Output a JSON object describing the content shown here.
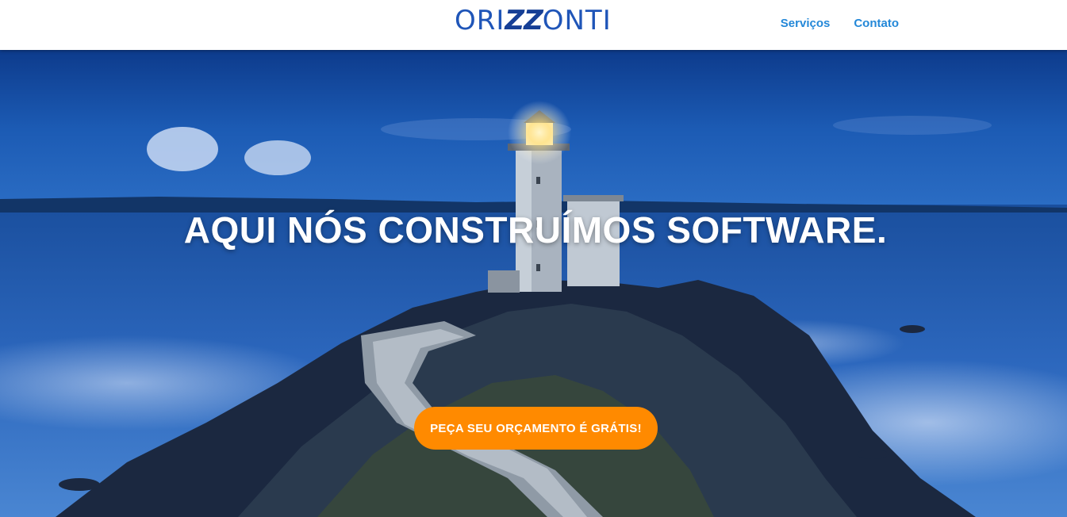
{
  "header": {
    "logo_prefix": "ORI",
    "logo_accent": "ZZ",
    "logo_suffix": "ONTI",
    "nav": [
      {
        "label": "Serviços"
      },
      {
        "label": "Contato"
      }
    ]
  },
  "hero": {
    "headline": "AQUI NÓS CONSTRUÍMOS SOFTWARE.",
    "cta_label": "PEÇA SEU ORÇAMENTO É GRÁTIS!",
    "background_image": "lighthouse-at-dusk"
  },
  "colors": {
    "brand_blue": "#1f55b8",
    "nav_link": "#2488d8",
    "cta_orange": "#ff8a00"
  }
}
